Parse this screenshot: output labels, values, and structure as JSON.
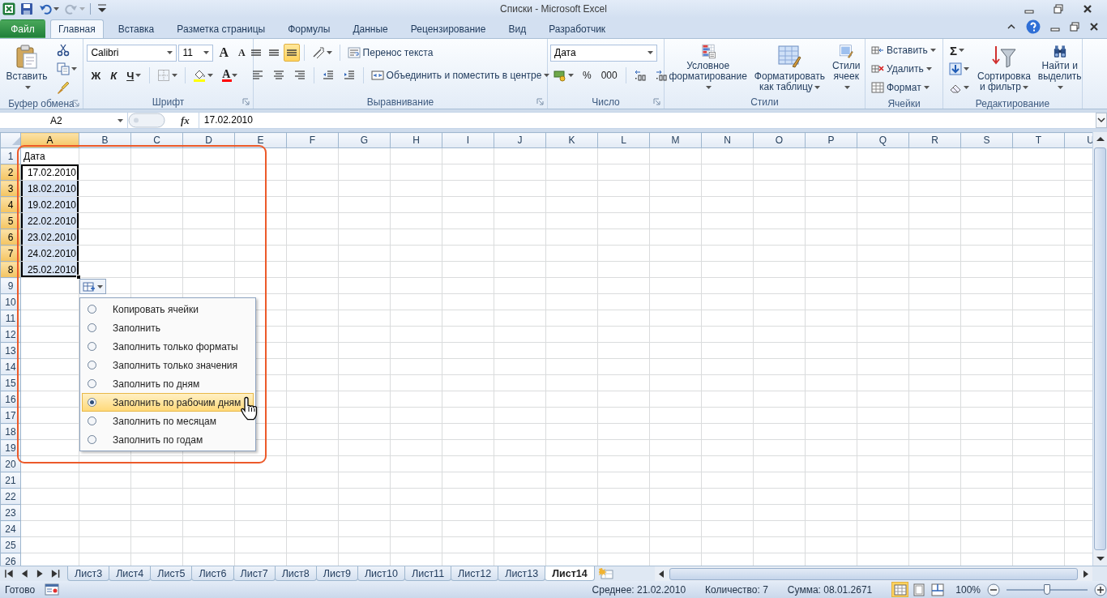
{
  "window": {
    "title": "Списки - Microsoft Excel"
  },
  "quick_access": [
    {
      "disabled": false
    },
    {
      "disabled": false
    },
    {
      "disabled": true
    },
    {
      "disabled": false
    }
  ],
  "ribbon": {
    "tabs": [
      {
        "label": "Файл",
        "kind": "file",
        "selected": false
      },
      {
        "label": "Главная",
        "kind": "tab",
        "selected": true
      },
      {
        "label": "Вставка",
        "kind": "tab",
        "selected": false
      },
      {
        "label": "Разметка страницы",
        "kind": "tab",
        "selected": false
      },
      {
        "label": "Формулы",
        "kind": "tab",
        "selected": false
      },
      {
        "label": "Данные",
        "kind": "tab",
        "selected": false
      },
      {
        "label": "Рецензирование",
        "kind": "tab",
        "selected": false
      },
      {
        "label": "Вид",
        "kind": "tab",
        "selected": false
      },
      {
        "label": "Разработчик",
        "kind": "tab",
        "selected": false
      }
    ],
    "groups": [
      {
        "label": "Буфер обмена",
        "launcher": true,
        "sections": [
          {
            "kind": "large",
            "label": "Вставить",
            "dropdown": true
          },
          {
            "kind": "stack",
            "items": [
              {
                "kind": "icon"
              },
              {
                "kind": "icon",
                "dropdown": true
              },
              {
                "kind": "icon"
              }
            ]
          }
        ]
      },
      {
        "label": "Шрифт",
        "launcher": true,
        "sections": [
          {
            "kind": "rows",
            "lines": [
              {
                "items": [
                  {
                    "kind": "font-combo",
                    "value": "Calibri"
                  },
                  {
                    "kind": "size-combo",
                    "value": "11"
                  },
                  {
                    "kind": "glyph",
                    "label": "A"
                  },
                  {
                    "kind": "glyph",
                    "label": "A"
                  }
                ]
              },
              {
                "items": [
                  {
                    "kind": "glyph",
                    "label": "Ж"
                  },
                  {
                    "kind": "glyph",
                    "label": "К"
                  },
                  {
                    "kind": "glyph",
                    "label": "Ч",
                    "dropdown": true
                  },
                  {
                    "kind": "separator"
                  },
                  {
                    "kind": "icon",
                    "dropdown": true
                  },
                  {
                    "kind": "separator"
                  },
                  {
                    "kind": "icon",
                    "dropdown": true
                  },
                  {
                    "kind": "glyph",
                    "label": "A",
                    "dropdown": true
                  }
                ]
              }
            ]
          }
        ]
      },
      {
        "label": "Выравнивание",
        "launcher": true,
        "sections": [
          {
            "kind": "rows",
            "lines": [
              {
                "items": [
                  {
                    "kind": "icon",
                    "selected": false
                  },
                  {
                    "kind": "icon",
                    "selected": false
                  },
                  {
                    "kind": "icon",
                    "selected": true
                  },
                  {
                    "kind": "separator"
                  },
                  {
                    "kind": "icon",
                    "dropdown": true
                  },
                  {
                    "kind": "separator"
                  },
                  {
                    "kind": "small",
                    "label": "Перенос текста"
                  }
                ]
              },
              {
                "items": [
                  {
                    "kind": "icon",
                    "selected": false
                  },
                  {
                    "kind": "icon",
                    "selected": false
                  },
                  {
                    "kind": "icon",
                    "selected": false
                  },
                  {
                    "kind": "separator"
                  },
                  {
                    "kind": "icon"
                  },
                  {
                    "kind": "icon"
                  },
                  {
                    "kind": "separator"
                  },
                  {
                    "kind": "small",
                    "label": "Объединить и поместить в центре",
                    "dropdown": true
                  }
                ]
              }
            ]
          }
        ]
      },
      {
        "label": "Число",
        "launcher": true,
        "sections": [
          {
            "kind": "rows",
            "lines": [
              {
                "items": [
                  {
                    "kind": "format-combo",
                    "value": "Дата"
                  }
                ]
              },
              {
                "items": [
                  {
                    "kind": "icon",
                    "dropdown": true
                  },
                  {
                    "kind": "glyph",
                    "label": "%"
                  },
                  {
                    "kind": "glyph",
                    "label": "000"
                  },
                  {
                    "kind": "separator"
                  },
                  {
                    "kind": "icon"
                  },
                  {
                    "kind": "icon"
                  }
                ]
              }
            ]
          }
        ]
      },
      {
        "label": "Стили",
        "launcher": false,
        "sections": [
          {
            "kind": "large",
            "label": "Условное\nформатирование",
            "dropdown": true
          },
          {
            "kind": "large",
            "label": "Форматировать\nкак таблицу",
            "dropdown": true
          },
          {
            "kind": "large",
            "label": "Стили\nячеек",
            "dropdown": true
          }
        ]
      },
      {
        "label": "Ячейки",
        "launcher": false,
        "sections": [
          {
            "kind": "stack",
            "items": [
              {
                "kind": "small",
                "label": "Вставить",
                "dropdown": true
              },
              {
                "kind": "small",
                "label": "Удалить",
                "dropdown": true
              },
              {
                "kind": "small",
                "label": "Формат",
                "dropdown": true
              }
            ]
          }
        ]
      },
      {
        "label": "Редактирование",
        "launcher": false,
        "sections": [
          {
            "kind": "stack",
            "items": [
              {
                "kind": "glyph",
                "label": "Σ",
                "dropdown": true
              },
              {
                "kind": "icon",
                "dropdown": true
              },
              {
                "kind": "icon",
                "dropdown": true
              }
            ]
          },
          {
            "kind": "large",
            "label": "Сортировка\nи фильтр",
            "dropdown": true
          },
          {
            "kind": "large",
            "label": "Найти и\nвыделить",
            "dropdown": true
          }
        ]
      }
    ]
  },
  "formula_bar": {
    "name_box": "A2",
    "fx": "fx",
    "value": "17.02.2010"
  },
  "grid": {
    "columns": [
      {
        "label": "A",
        "highlighted": true
      },
      {
        "label": "B",
        "highlighted": false
      },
      {
        "label": "C",
        "highlighted": false
      },
      {
        "label": "D",
        "highlighted": false
      },
      {
        "label": "E",
        "highlighted": false
      },
      {
        "label": "F",
        "highlighted": false
      },
      {
        "label": "G",
        "highlighted": false
      },
      {
        "label": "H",
        "highlighted": false
      },
      {
        "label": "I",
        "highlighted": false
      },
      {
        "label": "J",
        "highlighted": false
      },
      {
        "label": "K",
        "highlighted": false
      },
      {
        "label": "L",
        "highlighted": false
      },
      {
        "label": "M",
        "highlighted": false
      },
      {
        "label": "N",
        "highlighted": false
      },
      {
        "label": "O",
        "highlighted": false
      },
      {
        "label": "P",
        "highlighted": false
      },
      {
        "label": "Q",
        "highlighted": false
      },
      {
        "label": "R",
        "highlighted": false
      },
      {
        "label": "S",
        "highlighted": false
      },
      {
        "label": "T",
        "highlighted": false
      },
      {
        "label": "U",
        "highlighted": false
      }
    ],
    "rows": [
      {
        "number": "1",
        "highlighted": false,
        "cells": [
          {
            "text": "Дата",
            "kind": "text",
            "selected": false,
            "active": false
          }
        ]
      },
      {
        "number": "2",
        "highlighted": true,
        "cells": [
          {
            "text": "17.02.2010",
            "kind": "number",
            "selected": true,
            "active": true
          }
        ]
      },
      {
        "number": "3",
        "highlighted": true,
        "cells": [
          {
            "text": "18.02.2010",
            "kind": "number",
            "selected": true,
            "active": false
          }
        ]
      },
      {
        "number": "4",
        "highlighted": true,
        "cells": [
          {
            "text": "19.02.2010",
            "kind": "number",
            "selected": true,
            "active": false
          }
        ]
      },
      {
        "number": "5",
        "highlighted": true,
        "cells": [
          {
            "text": "22.02.2010",
            "kind": "number",
            "selected": true,
            "active": false
          }
        ]
      },
      {
        "number": "6",
        "highlighted": true,
        "cells": [
          {
            "text": "23.02.2010",
            "kind": "number",
            "selected": true,
            "active": false
          }
        ]
      },
      {
        "number": "7",
        "highlighted": true,
        "cells": [
          {
            "text": "24.02.2010",
            "kind": "number",
            "selected": true,
            "active": false
          }
        ]
      },
      {
        "number": "8",
        "highlighted": true,
        "cells": [
          {
            "text": "25.02.2010",
            "kind": "number",
            "selected": true,
            "active": false
          }
        ]
      },
      {
        "number": "9",
        "highlighted": false
      },
      {
        "number": "10",
        "highlighted": false
      },
      {
        "number": "11",
        "highlighted": false
      },
      {
        "number": "12",
        "highlighted": false
      },
      {
        "number": "13",
        "highlighted": false
      },
      {
        "number": "14",
        "highlighted": false
      },
      {
        "number": "15",
        "highlighted": false
      },
      {
        "number": "16",
        "highlighted": false
      },
      {
        "number": "17",
        "highlighted": false
      },
      {
        "number": "18",
        "highlighted": false
      },
      {
        "number": "19",
        "highlighted": false
      },
      {
        "number": "20",
        "highlighted": false
      },
      {
        "number": "21",
        "highlighted": false
      },
      {
        "number": "22",
        "highlighted": false
      },
      {
        "number": "23",
        "highlighted": false
      },
      {
        "number": "24",
        "highlighted": false
      },
      {
        "number": "25",
        "highlighted": false
      },
      {
        "number": "26",
        "highlighted": false
      }
    ]
  },
  "autofill_menu": {
    "items": [
      {
        "label": "Копировать ячейки",
        "selected": false
      },
      {
        "label": "Заполнить",
        "selected": false
      },
      {
        "label": "Заполнить только форматы",
        "selected": false
      },
      {
        "label": "Заполнить только значения",
        "selected": false
      },
      {
        "label": "Заполнить по дням",
        "selected": false
      },
      {
        "label": "Заполнить по рабочим дням",
        "selected": true
      },
      {
        "label": "Заполнить по месяцам",
        "selected": false
      },
      {
        "label": "Заполнить по годам",
        "selected": false
      }
    ]
  },
  "sheet_tabs": [
    {
      "label": "Лист3",
      "selected": false
    },
    {
      "label": "Лист4",
      "selected": false
    },
    {
      "label": "Лист5",
      "selected": false
    },
    {
      "label": "Лист6",
      "selected": false
    },
    {
      "label": "Лист7",
      "selected": false
    },
    {
      "label": "Лист8",
      "selected": false
    },
    {
      "label": "Лист9",
      "selected": false
    },
    {
      "label": "Лист10",
      "selected": false
    },
    {
      "label": "Лист11",
      "selected": false
    },
    {
      "label": "Лист12",
      "selected": false
    },
    {
      "label": "Лист13",
      "selected": false
    },
    {
      "label": "Лист14",
      "selected": true
    }
  ],
  "status_bar": {
    "ready": "Готово",
    "stats": [
      "Среднее: 21.02.2010",
      "Количество: 7",
      "Сумма: 08.01.2671"
    ],
    "views": [
      {
        "selected": true
      },
      {
        "selected": false
      },
      {
        "selected": false
      }
    ],
    "zoom": "100%",
    "zoom_slider": {
      "level": 0.5
    }
  }
}
